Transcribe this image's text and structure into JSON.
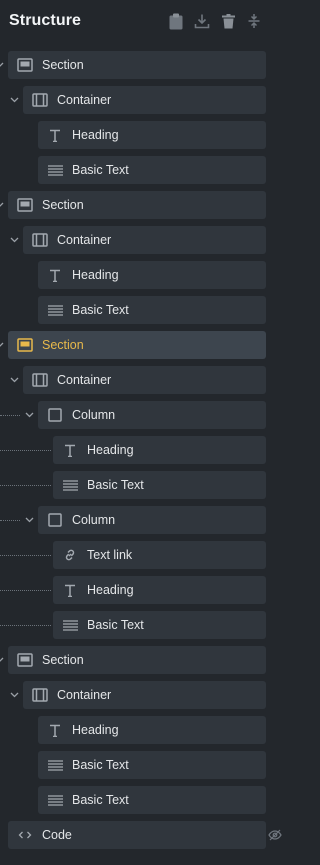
{
  "panel": {
    "title": "Structure",
    "header_icons": [
      "clipboard-icon",
      "download-icon",
      "trash-icon",
      "collapse-icon"
    ]
  },
  "tree": [
    {
      "label": "Section",
      "type": "section",
      "depth": 0
    },
    {
      "label": "Container",
      "type": "container",
      "depth": 1
    },
    {
      "label": "Heading",
      "type": "heading",
      "depth": 2
    },
    {
      "label": "Basic Text",
      "type": "text",
      "depth": 2
    },
    {
      "label": "Section",
      "type": "section",
      "depth": 0
    },
    {
      "label": "Container",
      "type": "container",
      "depth": 1
    },
    {
      "label": "Heading",
      "type": "heading",
      "depth": 2
    },
    {
      "label": "Basic Text",
      "type": "text",
      "depth": 2
    },
    {
      "label": "Section",
      "type": "section",
      "depth": 0,
      "selected": true
    },
    {
      "label": "Container",
      "type": "container",
      "depth": 1
    },
    {
      "label": "Column",
      "type": "column",
      "depth": 2
    },
    {
      "label": "Heading",
      "type": "heading",
      "depth": 3
    },
    {
      "label": "Basic Text",
      "type": "text",
      "depth": 3
    },
    {
      "label": "Column",
      "type": "column",
      "depth": 2
    },
    {
      "label": "Text link",
      "type": "link",
      "depth": 3
    },
    {
      "label": "Heading",
      "type": "heading",
      "depth": 3
    },
    {
      "label": "Basic Text",
      "type": "text",
      "depth": 3
    },
    {
      "label": "Section",
      "type": "section",
      "depth": 0
    },
    {
      "label": "Container",
      "type": "container",
      "depth": 1
    },
    {
      "label": "Heading",
      "type": "heading",
      "depth": 2
    },
    {
      "label": "Basic Text",
      "type": "text",
      "depth": 2
    },
    {
      "label": "Basic Text",
      "type": "text",
      "depth": 2
    },
    {
      "label": "Code",
      "type": "code",
      "depth": 0,
      "hidden": true
    }
  ],
  "colors": {
    "panel_bg": "#23272c",
    "row_bg": "#30363d",
    "row_selected_bg": "#3d454e",
    "selected_accent": "#e8b94b",
    "icon": "#a3a9b0"
  }
}
